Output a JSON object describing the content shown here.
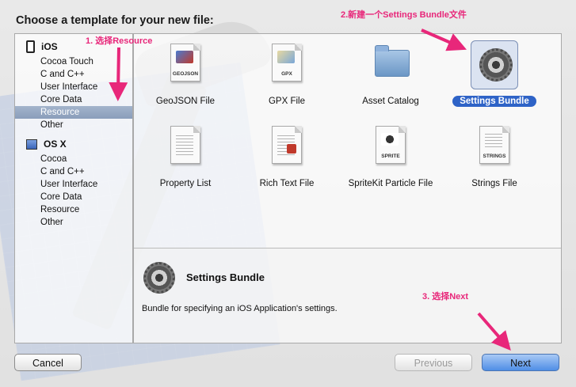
{
  "dialog": {
    "title": "Choose a template for your new file:"
  },
  "sidebar": {
    "groups": [
      {
        "label": "iOS",
        "items": [
          "Cocoa Touch",
          "C and C++",
          "User Interface",
          "Core Data",
          "Resource",
          "Other"
        ]
      },
      {
        "label": "OS X",
        "items": [
          "Cocoa",
          "C and C++",
          "User Interface",
          "Core Data",
          "Resource",
          "Other"
        ]
      }
    ],
    "selected": "iOS / Resource"
  },
  "templates": [
    {
      "label": "GeoJSON File",
      "icon": "geojson-file-icon",
      "badge": "GEOJSON"
    },
    {
      "label": "GPX File",
      "icon": "gpx-file-icon",
      "badge": "GPX"
    },
    {
      "label": "Asset Catalog",
      "icon": "folder-icon"
    },
    {
      "label": "Settings Bundle",
      "icon": "gear-icon",
      "selected": true
    },
    {
      "label": "Property List",
      "icon": "property-list-icon"
    },
    {
      "label": "Rich Text File",
      "icon": "rich-text-file-icon"
    },
    {
      "label": "SpriteKit Particle File",
      "icon": "sprite-file-icon",
      "badge": "SPRITE"
    },
    {
      "label": "Strings File",
      "icon": "strings-file-icon",
      "badge": "STRINGS"
    }
  ],
  "description": {
    "title": "Settings Bundle",
    "text": "Bundle for specifying an iOS Application's settings."
  },
  "buttons": {
    "cancel": "Cancel",
    "previous": "Previous",
    "next": "Next"
  },
  "annotations": {
    "step1": "1. 选择Resource",
    "step2": "2.新建一个Settings Bundle文件",
    "step3": "3. 选择Next"
  },
  "colors": {
    "accent": "#2e63c7",
    "annotation": "#e8277a",
    "next_button": "#4f8ee6"
  }
}
